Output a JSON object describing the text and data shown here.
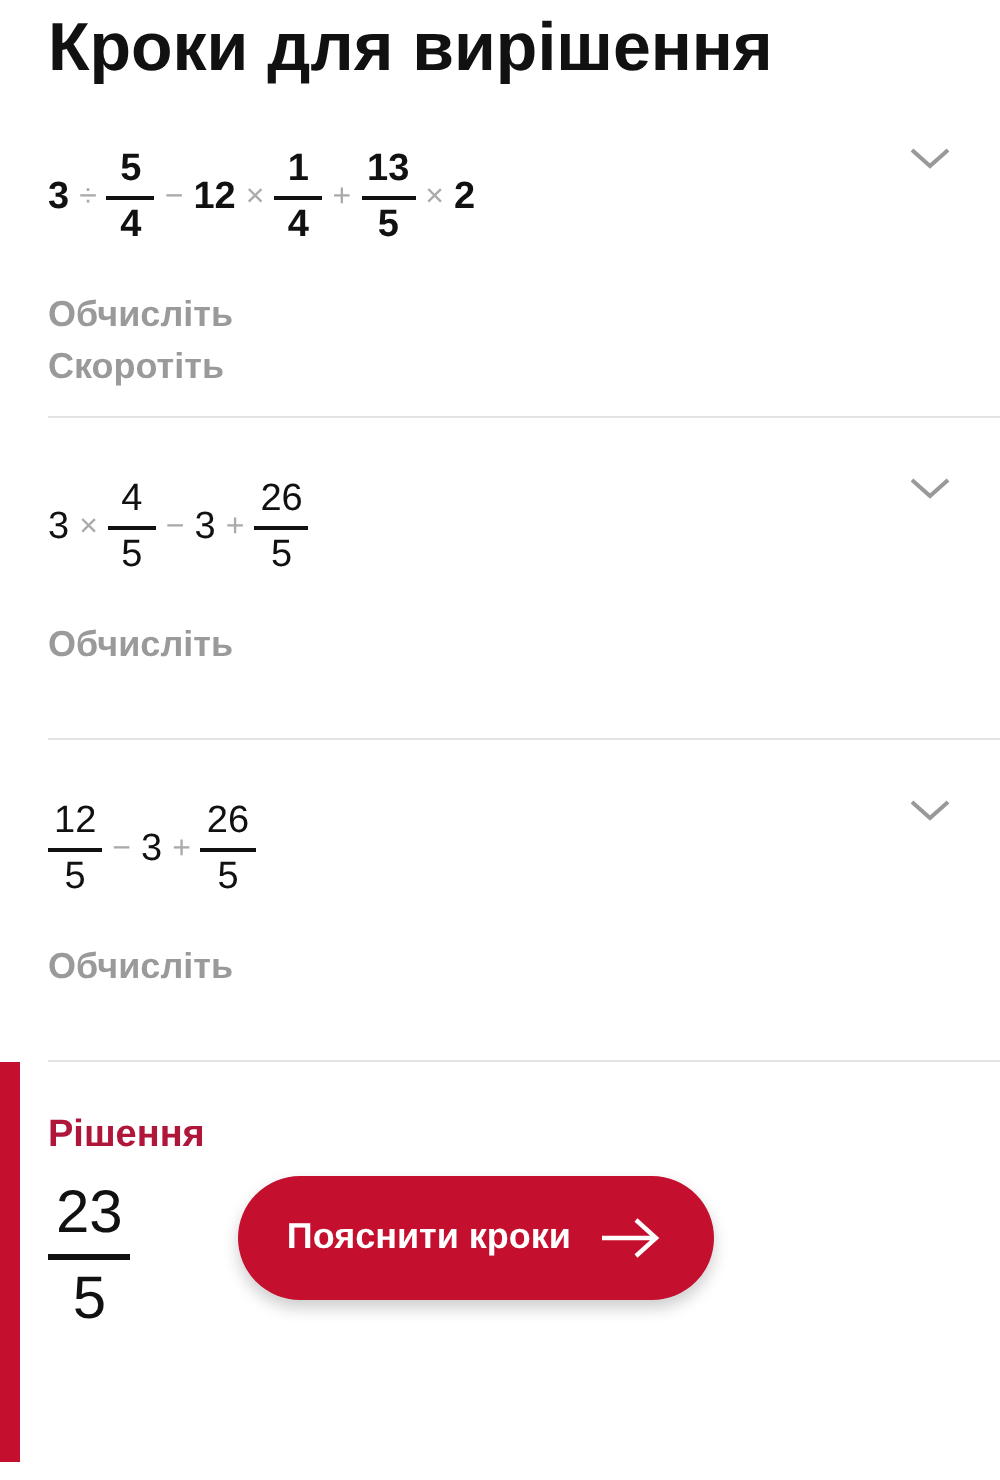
{
  "title": "Кроки для вирішення",
  "steps": [
    {
      "highlighted": true,
      "expanded": false,
      "expression": [
        {
          "kind": "number",
          "text": "3"
        },
        {
          "kind": "operator",
          "text": "÷"
        },
        {
          "kind": "fraction",
          "numerator": "5",
          "denominator": "4"
        },
        {
          "kind": "operator",
          "text": "−"
        },
        {
          "kind": "number",
          "text": "12"
        },
        {
          "kind": "operator",
          "text": "×"
        },
        {
          "kind": "fraction",
          "numerator": "1",
          "denominator": "4"
        },
        {
          "kind": "operator",
          "text": "+"
        },
        {
          "kind": "fraction",
          "numerator": "13",
          "denominator": "5"
        },
        {
          "kind": "operator",
          "text": "×"
        },
        {
          "kind": "number",
          "text": "2"
        }
      ],
      "actions": [
        "Обчисліть",
        "Скоротіть"
      ]
    },
    {
      "highlighted": false,
      "expanded": false,
      "expression": [
        {
          "kind": "number",
          "text": "3"
        },
        {
          "kind": "operator",
          "text": "×"
        },
        {
          "kind": "fraction",
          "numerator": "4",
          "denominator": "5"
        },
        {
          "kind": "operator",
          "text": "−"
        },
        {
          "kind": "number",
          "text": "3"
        },
        {
          "kind": "operator",
          "text": "+"
        },
        {
          "kind": "fraction",
          "numerator": "26",
          "denominator": "5"
        }
      ],
      "actions": [
        "Обчисліть"
      ]
    },
    {
      "highlighted": false,
      "expanded": false,
      "expression": [
        {
          "kind": "fraction",
          "numerator": "12",
          "denominator": "5"
        },
        {
          "kind": "operator",
          "text": "−"
        },
        {
          "kind": "number",
          "text": "3"
        },
        {
          "kind": "operator",
          "text": "+"
        },
        {
          "kind": "fraction",
          "numerator": "26",
          "denominator": "5"
        }
      ],
      "actions": [
        "Обчисліть"
      ]
    }
  ],
  "solution": {
    "label": "Рішення",
    "numerator": "23",
    "denominator": "5",
    "button": "Пояснити кроки"
  }
}
